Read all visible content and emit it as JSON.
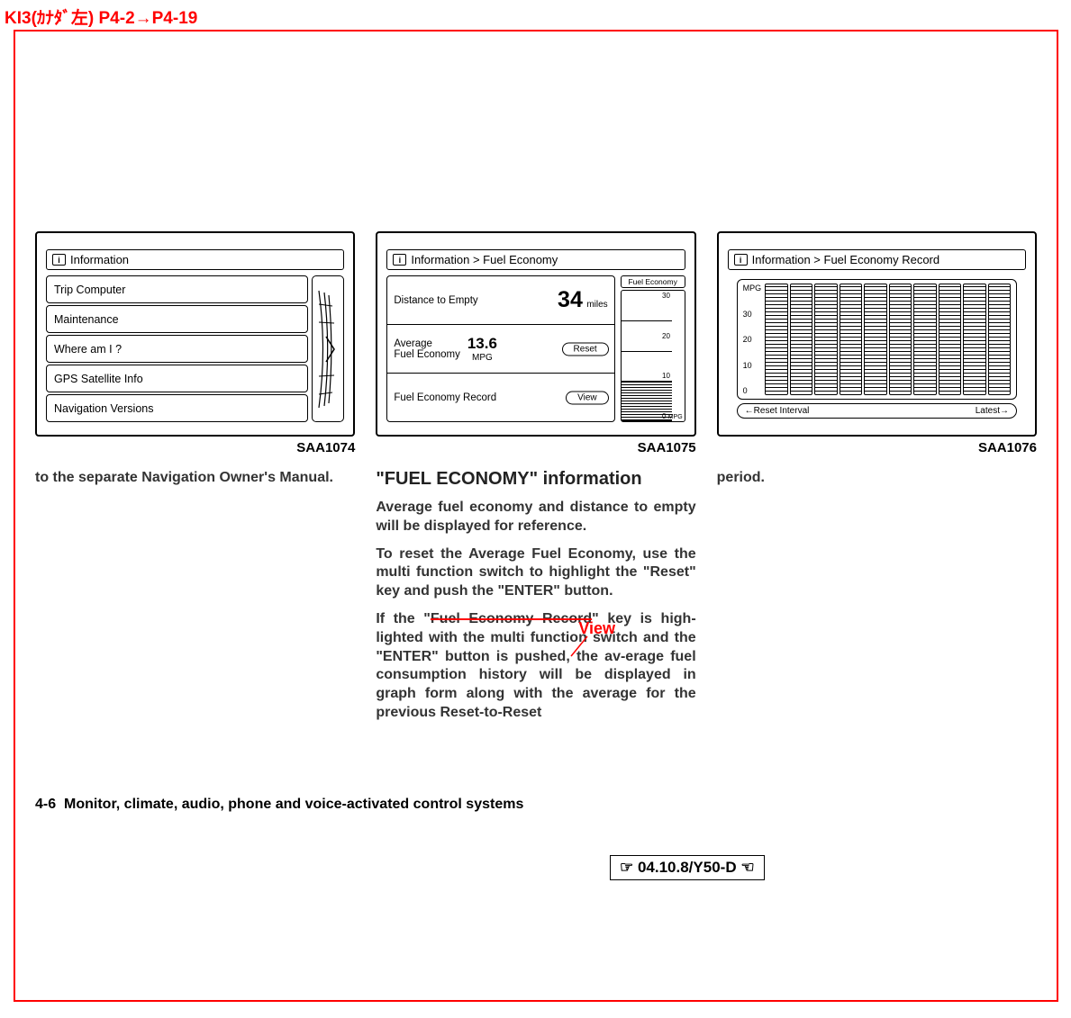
{
  "header_annotation": "KI3(ｶﾅﾀﾞ左) P4-2→P4-19",
  "figures": {
    "f1": {
      "caption": "SAA1074",
      "title": "Information",
      "menu": [
        "Trip Computer",
        "Maintenance",
        "Where am I ?",
        "GPS Satellite Info",
        "Navigation Versions"
      ]
    },
    "f2": {
      "caption": "SAA1075",
      "title": "Information > Fuel Economy",
      "dte_label": "Distance to Empty",
      "dte_value": "34",
      "dte_unit": "miles",
      "afe_label1": "Average",
      "afe_label2": "Fuel Economy",
      "afe_value": "13.6",
      "afe_unit": "MPG",
      "reset_btn": "Reset",
      "record_label": "Fuel Economy Record",
      "view_btn": "View",
      "right_title": "Fuel Economy",
      "scale": [
        "30",
        "20",
        "10",
        "0"
      ],
      "scale_unit": "MPG"
    },
    "f3": {
      "caption": "SAA1076",
      "title": "Information > Fuel Economy Record",
      "y_label": "MPG",
      "y_ticks": [
        "30",
        "20",
        "10",
        "0"
      ],
      "btn_left": "Reset Interval",
      "btn_right": "Latest"
    }
  },
  "col1": {
    "p1": "to the separate Navigation Owner's Manual."
  },
  "col2": {
    "h3": "\"FUEL ECONOMY\" information",
    "p1": "Average fuel economy and distance to empty will be displayed for reference.",
    "p2a": "To reset the Average Fuel Economy, use the multi function switch to highlight the ",
    "p2_reset": "\"Reset\"",
    "p2b": " key and push the ",
    "p2_enter": "\"ENTER\"",
    "p2c": " button.",
    "p3a": "If the \"",
    "p3_strike": "Fuel Economy Record",
    "p3b": "\" key is high-lighted with the multi function switch and the ",
    "p3_enter": "\"ENTER\"",
    "p3c": " button is pushed, the av-erage fuel consumption history will be displayed in graph form along with the average for the previous Reset-to-Reset"
  },
  "col3": {
    "p1": "period."
  },
  "annotation_view": "View",
  "footer": {
    "pagenum": "4-6",
    "chapter": "Monitor, climate, audio, phone and voice-activated control systems",
    "stamp": "☞ 04.10.8/Y50-D ☜"
  }
}
